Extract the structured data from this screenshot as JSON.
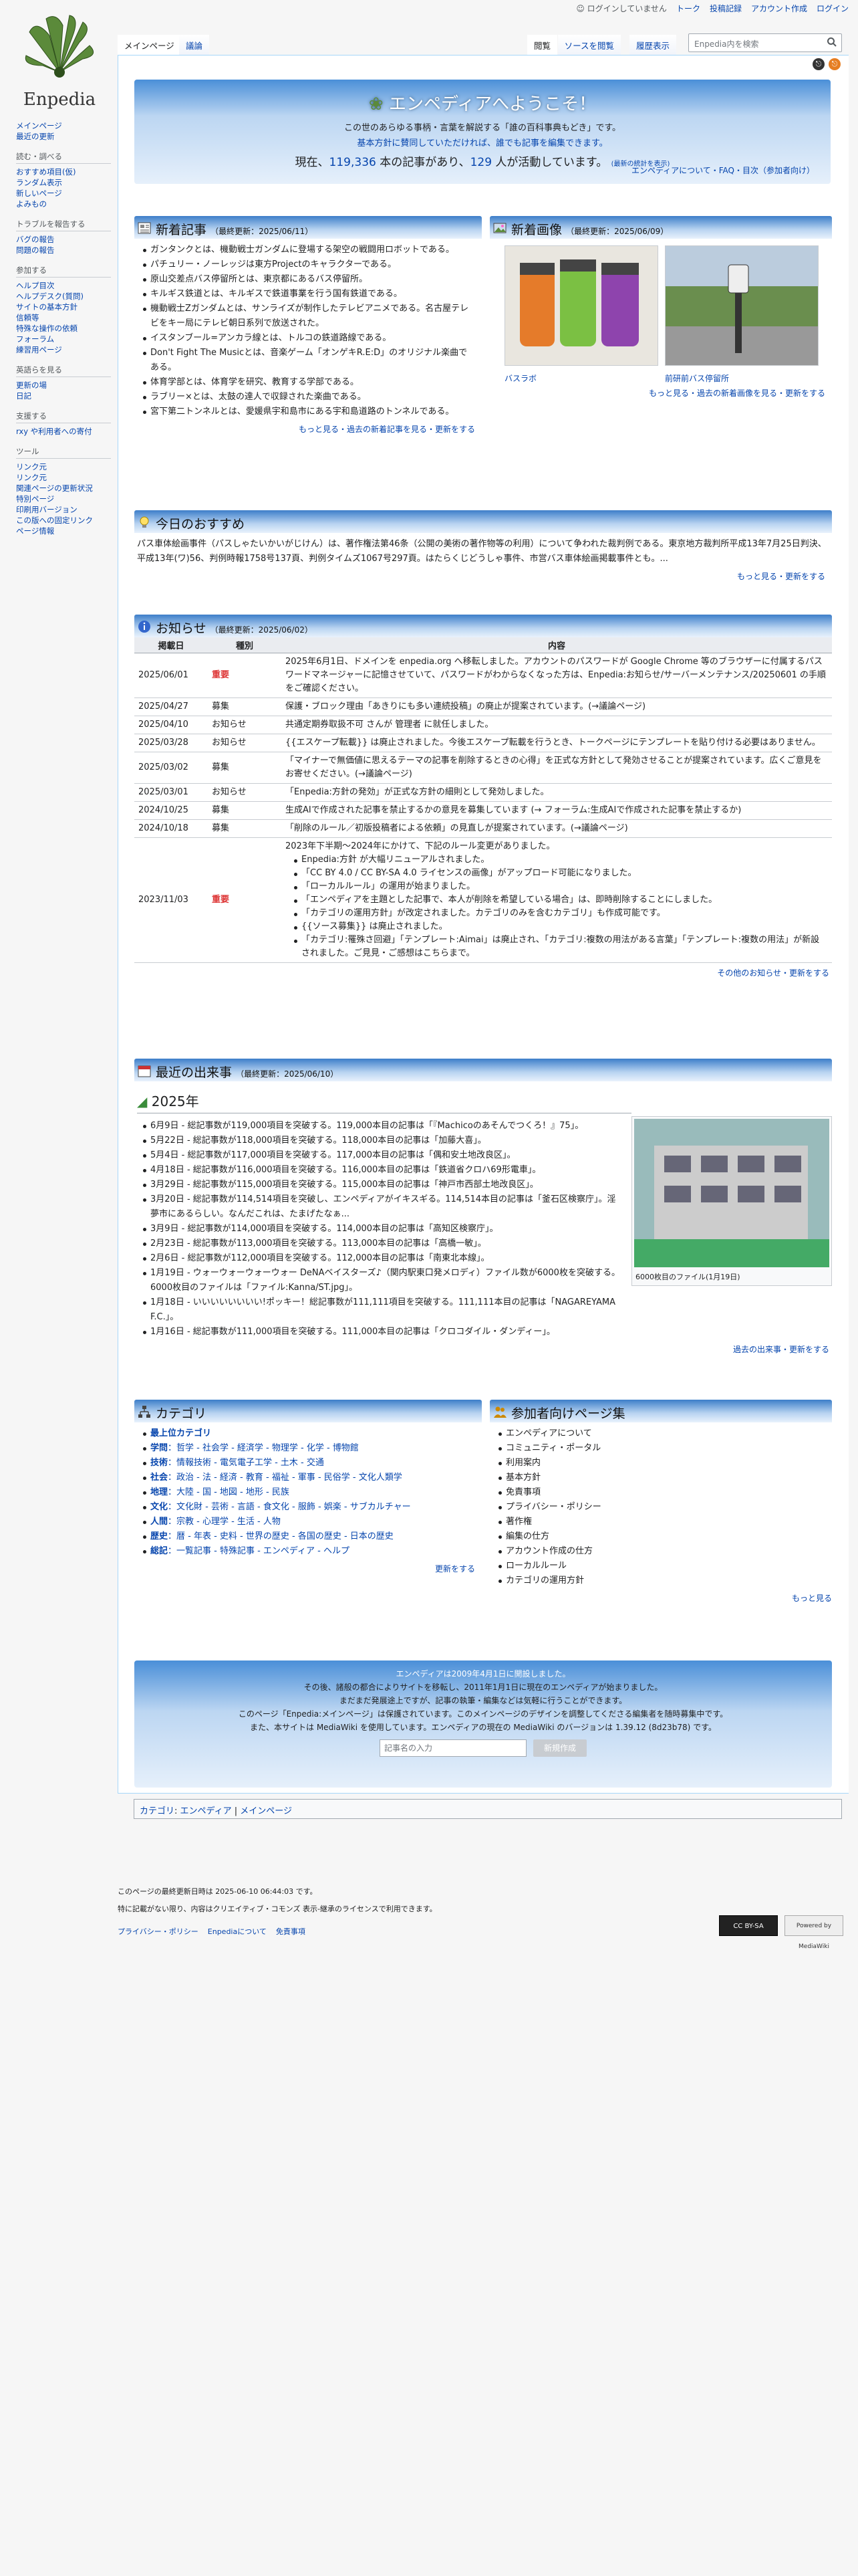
{
  "site": {
    "logo_text": "Enpedia"
  },
  "personal": {
    "not_logged_in": "ログインしていません",
    "talk": "トーク",
    "contributions": "投稿記録",
    "create_account": "アカウント作成",
    "login": "ログイン"
  },
  "tabs": {
    "main": "メインページ",
    "discussion": "議論",
    "read": "閲覧",
    "view_source": "ソースを閲覧",
    "history": "履歴表示"
  },
  "search": {
    "placeholder": "Enpedia内を検索"
  },
  "sidebar": {
    "top": [
      "メインページ",
      "最近の更新"
    ],
    "sections": [
      {
        "title": "読む・調べる",
        "items": [
          "おすすめ項目(仮)",
          "ランダム表示",
          "新しいページ",
          "よみもの"
        ]
      },
      {
        "title": "トラブルを報告する",
        "items": [
          "バグの報告",
          "問題の報告"
        ]
      },
      {
        "title": "参加する",
        "items": [
          "ヘルプ目次",
          "ヘルプデスク(質問)",
          "サイトの基本方針",
          "信頼等",
          "特殊な操作の依頼",
          "フォーラム",
          "練習用ページ"
        ]
      },
      {
        "title": "英語らを見る",
        "items": [
          "更新の場",
          "日記"
        ]
      },
      {
        "title": "支援する",
        "items": [
          "rxy や利用者への寄付"
        ]
      },
      {
        "title": "ツール",
        "items": [
          "リンク元",
          "リンク元",
          "関連ページの更新状況",
          "特別ページ",
          "印刷用バージョン",
          "この版への固定リンク",
          "ページ情報"
        ]
      }
    ]
  },
  "welcome": {
    "title": "エンペディアへようこそ！",
    "line1": "この世のあらゆる事柄・言葉を解説する「誰の百科事典もどき」です。",
    "line2": "基本方針に賛同していただければ、誰でも記事を編集できます。",
    "line3a": "現在、",
    "articles": "119,336",
    "line3b": " 本の記事があり、",
    "active": "129",
    "line3c": " 人が活動しています。",
    "refresh": "(最新の統計を表示)",
    "links": "エンペディアについて・FAQ・目次（参加者向け）"
  },
  "new_articles": {
    "title": "新着記事",
    "updated": "（最終更新：2025/06/11）",
    "items": [
      "ガンタンクとは、機動戦士ガンダムに登場する架空の戦闘用ロボットである。",
      "パチュリー・ノーレッジは東方Projectのキャラクターである。",
      "原山交差点バス停留所とは、東京都にあるバス停留所。",
      "キルギス鉄道とは、キルギスで鉄道事業を行う国有鉄道である。",
      "機動戦士Zガンダムとは、サンライズが制作したテレビアニメである。名古屋テレビをキー局にテレビ朝日系列で放送された。",
      "イスタンブール=アンカラ線とは、トルコの鉄道路線である。",
      "Don't Fight The Musicとは、音楽ゲーム「オンゲキR.E:D」のオリジナル楽曲である。",
      "体育学部とは、体育学を研究、教育する学部である。",
      "ラブリー×とは、太鼓の達人で収録された楽曲である。",
      "宮下第二トンネルとは、愛媛県宇和島市にある宇和島道路のトンネルである。"
    ],
    "more": "もっと見る・過去の新着記事を見る・更新をする"
  },
  "new_images": {
    "title": "新着画像",
    "updated": "（最終更新：2025/06/09）",
    "captions": [
      "バスラボ",
      "前研前バス停留所"
    ],
    "more": "もっと見る・過去の新着画像を見る・更新をする"
  },
  "recommend": {
    "title": "今日のおすすめ",
    "text": "パス車体絵画事件（パスしゃたいかいがじけん）は、著作権法第46条（公開の美術の著作物等の利用）について争われた裁判例である。東京地方裁判所平成13年7月25日判決、平成13年(ワ)56、判例時報1758号137頁、判例タイムズ1067号297頁。はたらくじどうしゃ事件、市営バス車体絵画掲載事件とも。...",
    "more": "もっと見る・更新をする"
  },
  "notices": {
    "title": "お知らせ",
    "updated": "（最終更新：2025/06/02）",
    "headers": [
      "掲載日",
      "種別",
      "内容"
    ],
    "rows": [
      {
        "date": "2025/06/01",
        "type": "重要",
        "content": "2025年6月1日、ドメインを enpedia.org へ移転しました。アカウントのパスワードが Google Chrome 等のブラウザーに付属するパスワードマネージャーに記憶させていて、パスワードがわからなくなった方は、Enpedia:お知らせ/サーバーメンテナンス/20250601 の手順をご確認ください。"
      },
      {
        "date": "2025/04/27",
        "type": "募集",
        "content": "保護・ブロック理由「あきりにも多い連続投稿」の廃止が提案されています。(→議論ページ)"
      },
      {
        "date": "2025/04/10",
        "type": "お知らせ",
        "content": "共通定期券取扱不可 さんが 管理者 に就任しました。"
      },
      {
        "date": "2025/03/28",
        "type": "お知らせ",
        "content": "{{エスケープ転載}} は廃止されました。今後エスケープ転載を行うとき、トークページにテンプレートを貼り付ける必要はありません。"
      },
      {
        "date": "2025/03/02",
        "type": "募集",
        "content": "「マイナーで無価値に思えるテーマの記事を削除するときの心得」を正式な方針として発効させることが提案されています。広くご意見をお寄せください。(→議論ページ)"
      },
      {
        "date": "2025/03/01",
        "type": "お知らせ",
        "content": "「Enpedia:方針の発効」が正式な方針の細則として発効しました。"
      },
      {
        "date": "2024/10/25",
        "type": "募集",
        "content": "生成AIで作成された記事を禁止するかの意見を募集しています (→ フォーラム:生成AIで作成された記事を禁止するか)"
      },
      {
        "date": "2024/10/18",
        "type": "募集",
        "content": "「削除のルール／初版投稿者による依頼」の見直しが提案されています。(→議論ページ)"
      }
    ],
    "big": {
      "date": "2023/11/03",
      "type": "重要",
      "intro": "2023年下半期〜2024年にかけて、下記のルール変更がありました。",
      "items": [
        "Enpedia:方針 が大幅リニューアルされました。",
        "「CC BY 4.0 / CC BY-SA 4.0 ライセンスの画像」がアップロード可能になりました。",
        "「ローカルルール」の運用が始まりました。",
        "「エンペディアを主題とした記事で、本人が削除を希望している場合」は、即時削除することにしました。",
        "「カテゴリの運用方針」が改定されました。カテゴリのみを含むカテゴリ」も作成可能です。",
        "{{ソース募集}} は廃止されました。",
        "「カテゴリ:罹殊さ回避」「テンプレート:Aimai」は廃止され、「カテゴリ:複数の用法がある言葉」「テンプレート:複数の用法」が新設されました。ご見見・ご感想はこちらまで。"
      ]
    },
    "more": "その他のお知らせ・更新をする"
  },
  "events": {
    "title": "最近の出来事",
    "updated": "（最終更新：2025/06/10）",
    "year": "2025年",
    "items": [
      "6月9日 - 総記事数が119,000項目を突破する。119,000本目の記事は「『Machicoのあそんでつくろ！』75」。",
      "5月22日 - 総記事数が118,000項目を突破する。118,000本目の記事は「加藤大喜」。",
      "5月4日 - 総記事数が117,000項目を突破する。117,000本目の記事は「偶和安土地改良区」。",
      "4月18日 - 総記事数が116,000項目を突破する。116,000本目の記事は「鉄道省クロハ69形電車」。",
      "3月29日 - 総記事数が115,000項目を突破する。115,000本目の記事は「神戸市西部土地改良区」。",
      "3月20日 - 総記事数が114,514項目を突破し、エンペディアがイキスギる。114,514本目の記事は「釜石区検察庁」。淫夢市にあるらしい。なんだこれは、たまげたなぁ...",
      "3月9日 - 総記事数が114,000項目を突破する。114,000本目の記事は「高知区検察庁」。",
      "2月23日 - 総記事数が113,000項目を突破する。113,000本目の記事は「高橋一敏」。",
      "2月6日 - 総記事数が112,000項目を突破する。112,000本目の記事は「南東北本線」。",
      "1月19日 - ウォーウォーウォーウォー DeNAベイスターズ♪（関内駅東口発メロディ）ファイル数が6000枚を突破する。6000枚目のファイルは「ファイル:Kanna/ST.jpg」。",
      "1月18日 - いいいいいいいい!ポッキー！総記事数が111,111項目を突破する。111,111本目の記事は「NAGAREYAMA F.C.」。",
      "1月16日 - 総記事数が111,000項目を突破する。111,000本目の記事は「クロコダイル・ダンディー」。"
    ],
    "img_caption": "6000枚目のファイル(1月19日)",
    "more": "過去の出来事・更新をする"
  },
  "categories": {
    "title": "カテゴリ",
    "items": [
      {
        "head": "最上位カテゴリ",
        "rest": ""
      },
      {
        "head": "学問",
        "rest": "：哲学 - 社会学 - 経済学 - 物理学 - 化学 - 博物館"
      },
      {
        "head": "技術",
        "rest": "：情報技術 - 電気電子工学 - 土木 - 交通"
      },
      {
        "head": "社会",
        "rest": "：政治 - 法 - 経済 - 教育 - 福祉 - 軍事 - 民俗学 - 文化人類学"
      },
      {
        "head": "地理",
        "rest": "：大陸 - 国 - 地図 - 地形 - 民族"
      },
      {
        "head": "文化",
        "rest": "：文化財 - 芸術 - 言語 - 食文化 - 服飾 - 娯楽 - サブカルチャー"
      },
      {
        "head": "人間",
        "rest": "：宗教 - 心理学 - 生活 - 人物"
      },
      {
        "head": "歴史",
        "rest": "：暦 - 年表 - 史料 - 世界の歴史 - 各国の歴史 - 日本の歴史"
      },
      {
        "head": "総記",
        "rest": "：一覧記事 - 特殊記事 - エンペディア - ヘルプ"
      }
    ],
    "more": "更新をする"
  },
  "participants": {
    "title": "参加者向けページ集",
    "items": [
      "エンペディアについて",
      "コミュニティ・ポータル",
      "利用案内",
      "基本方針",
      "免責事項",
      "プライバシー・ポリシー",
      "著作権",
      "編集の仕方",
      "アカウント作成の仕方",
      "ローカルルール",
      "カテゴリの運用方針"
    ],
    "more": "もっと見る"
  },
  "bottom": {
    "l1": "エンペディアは2009年4月1日に開設しました。",
    "l2": "その後、諸般の都合によりサイトを移転し、2011年1月1日に現在のエンペディアが始まりました。",
    "l3": "まだまだ発展途上ですが、記事の執筆・編集などは気軽に行うことができます。",
    "l4": "このページ「Enpedia:メインページ」は保護されています。このメインページのデザインを調整してくださる編集者を随時募集中です。",
    "l5": "また、本サイトは MediaWiki を使用しています。エンペディアの現在の MediaWiki のバージョンは 1.39.12 (8d23b78) です。",
    "input_placeholder": "記事名の入力",
    "button": "新規作成"
  },
  "catlinks": {
    "label": "カテゴリ",
    "items": [
      "エンペディア",
      "メインページ"
    ]
  },
  "footer": {
    "lastmod": "このページの最終更新日時は 2025-06-10 06:44:03 です。",
    "license": "特に記載がない限り、内容はクリエイティブ・コモンズ 表示-継承のライセンスで利用できます。",
    "links": [
      "プライバシー・ポリシー",
      "Enpediaについて",
      "免責事項"
    ],
    "cc": "CC BY-SA",
    "powered": "Powered by MediaWiki"
  }
}
